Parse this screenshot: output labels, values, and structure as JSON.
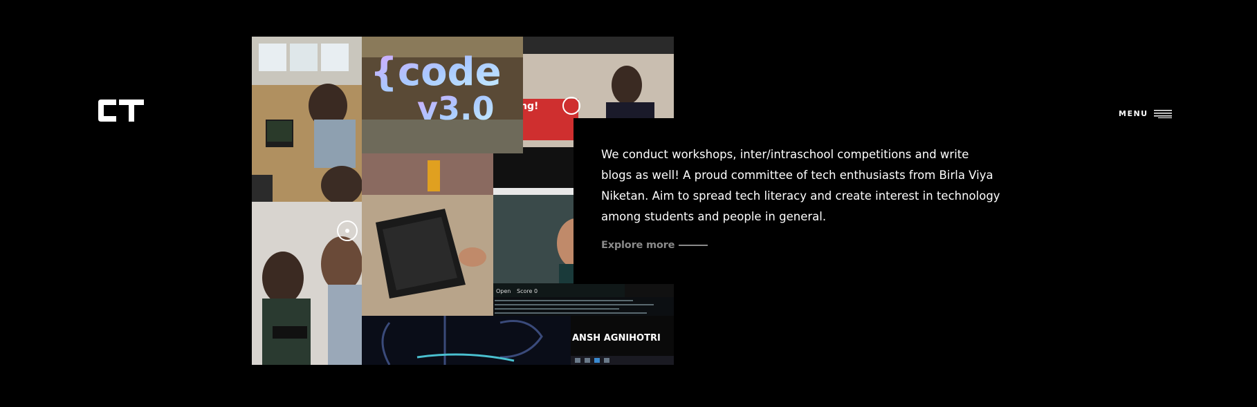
{
  "header": {
    "logo_text": "CT",
    "menu_label": "MENU",
    "menu_icon": "hamburger-icon"
  },
  "collage": {
    "tiles": [
      {
        "name": "photo-computer-lab",
        "caption": ""
      },
      {
        "name": "photo-code-poster",
        "caption_line1": "{code",
        "caption_line2": "v3.0",
        "side_text": "ng!"
      },
      {
        "name": "photo-presenter-stage",
        "caption": ""
      },
      {
        "name": "photo-students-gaming",
        "caption": ""
      },
      {
        "name": "photo-laptop-table",
        "caption": ""
      },
      {
        "name": "photo-video-call",
        "caption_open": "Open",
        "caption_score": "Score 0"
      },
      {
        "name": "photo-code-graphic",
        "caption": ""
      },
      {
        "name": "photo-video-name",
        "caption": "ANSH AGNIHOTRI"
      }
    ]
  },
  "about": {
    "description": "We conduct workshops, inter/intraschool competitions and write blogs as well! A proud committee of tech enthusiasts from Birla Viya Niketan. Aim to spread tech literacy and create interest in technology among students and people in general.",
    "explore_label": "Explore more"
  },
  "colors": {
    "background": "#000000",
    "text": "#ffffff",
    "muted": "#8a8a8a"
  }
}
